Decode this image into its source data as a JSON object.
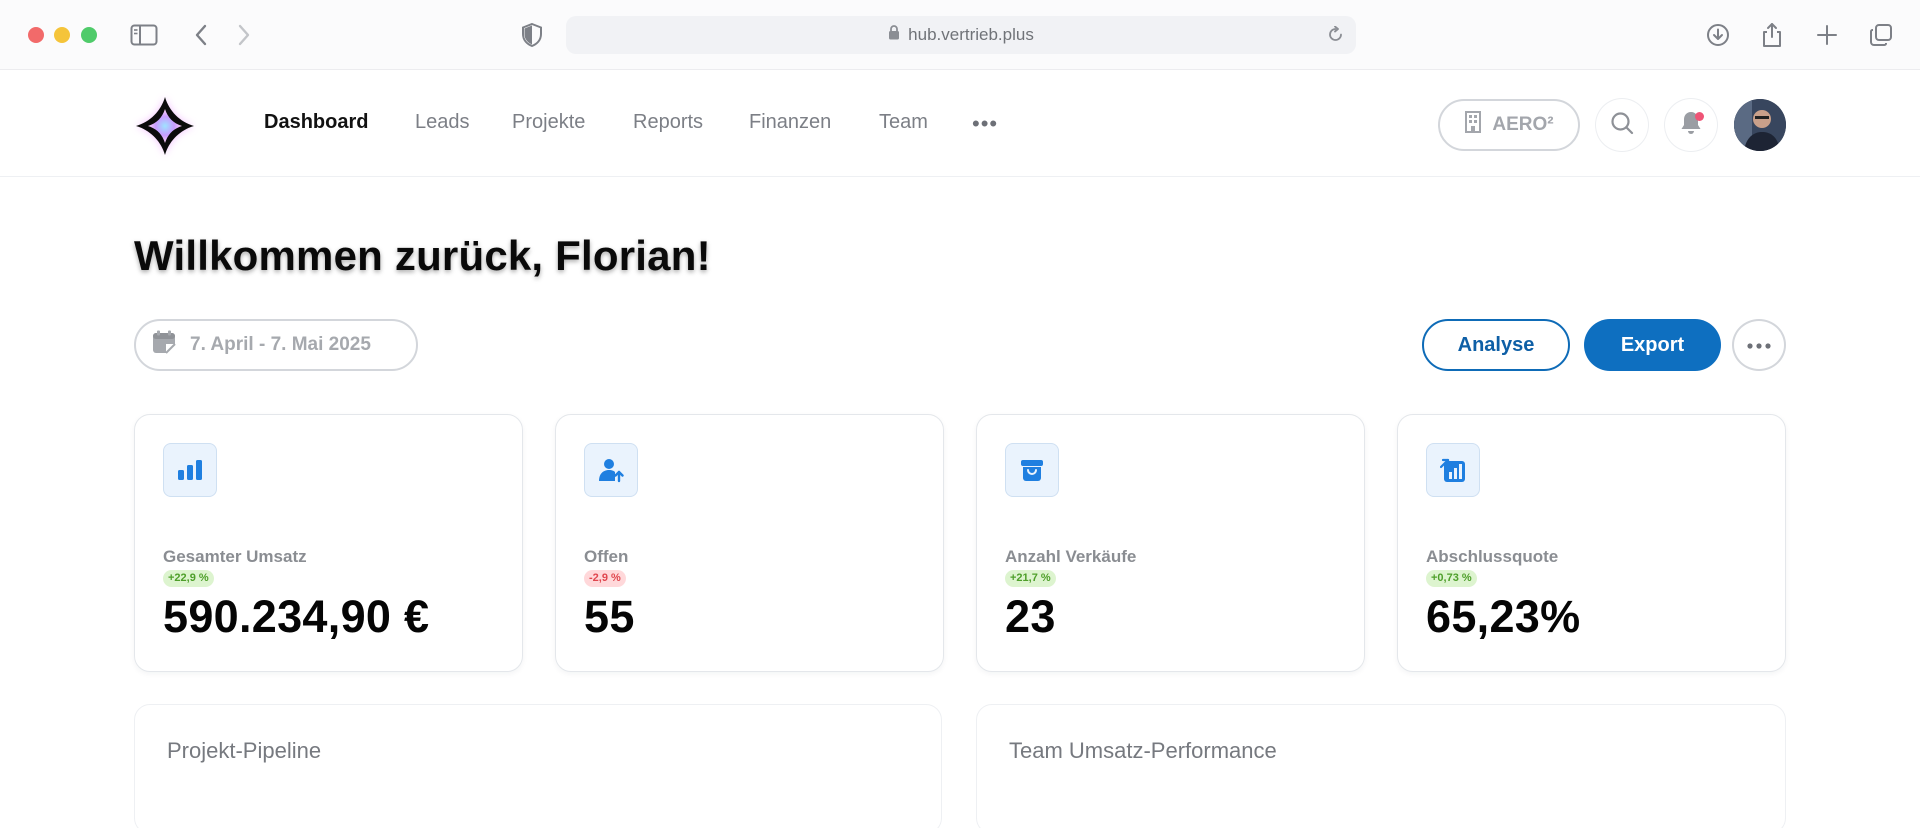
{
  "browser": {
    "url": "hub.vertrieb.plus"
  },
  "nav": {
    "items": [
      {
        "label": "Dashboard",
        "active": true
      },
      {
        "label": "Leads",
        "active": false
      },
      {
        "label": "Projekte",
        "active": false
      },
      {
        "label": "Reports",
        "active": false
      },
      {
        "label": "Finanzen",
        "active": false
      },
      {
        "label": "Team",
        "active": false
      }
    ],
    "more_label": "•••",
    "company": "AERO²"
  },
  "header": {
    "welcome": "Willkommen zurück, Florian!",
    "date_range": "7. April - 7. Mai 2025",
    "analyse_label": "Analyse",
    "export_label": "Export"
  },
  "kpis": [
    {
      "label": "Gesamter Umsatz",
      "change": "+22,9 %",
      "trend": "up",
      "value": "590.234,90 €",
      "icon": "bar-chart-icon"
    },
    {
      "label": "Offen",
      "change": "-2,9 %",
      "trend": "down",
      "value": "55",
      "icon": "user-upload-icon"
    },
    {
      "label": "Anzahl Verkäufe",
      "change": "+21,7 %",
      "trend": "up",
      "value": "23",
      "icon": "shopping-bag-icon"
    },
    {
      "label": "Abschlussquote",
      "change": "+0,73 %",
      "trend": "up",
      "value": "65,23%",
      "icon": "rate-chart-icon"
    }
  ],
  "panels": [
    {
      "title": "Projekt-Pipeline"
    },
    {
      "title": "Team Umsatz-Performance"
    }
  ],
  "colors": {
    "primary": "#0e6fc0",
    "badge_up_bg": "#ddf4cf",
    "badge_down_bg": "#ffd8da",
    "icon_blue": "#1f7fe0"
  }
}
